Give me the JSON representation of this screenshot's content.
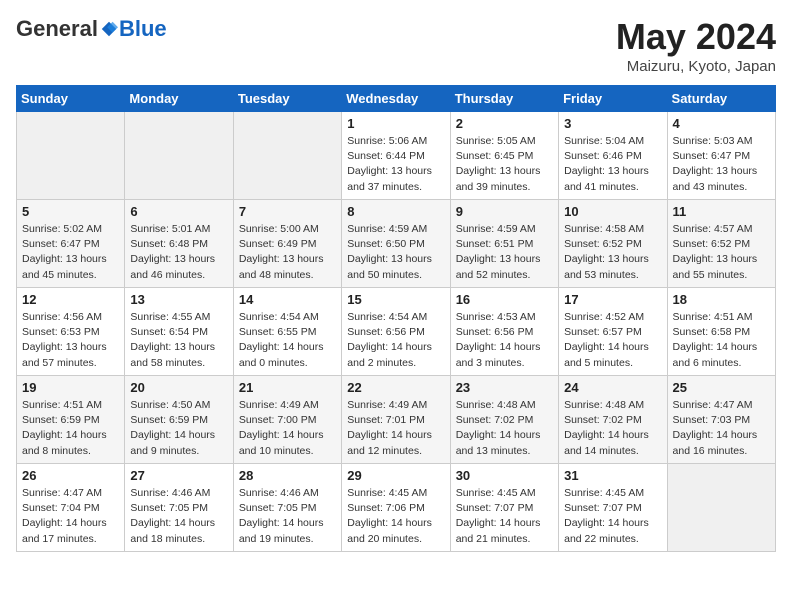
{
  "header": {
    "logo_general": "General",
    "logo_blue": "Blue",
    "month": "May 2024",
    "location": "Maizuru, Kyoto, Japan"
  },
  "weekdays": [
    "Sunday",
    "Monday",
    "Tuesday",
    "Wednesday",
    "Thursday",
    "Friday",
    "Saturday"
  ],
  "weeks": [
    [
      null,
      null,
      null,
      {
        "day": 1,
        "sunrise": "5:06 AM",
        "sunset": "6:44 PM",
        "daylight": "13 hours and 37 minutes."
      },
      {
        "day": 2,
        "sunrise": "5:05 AM",
        "sunset": "6:45 PM",
        "daylight": "13 hours and 39 minutes."
      },
      {
        "day": 3,
        "sunrise": "5:04 AM",
        "sunset": "6:46 PM",
        "daylight": "13 hours and 41 minutes."
      },
      {
        "day": 4,
        "sunrise": "5:03 AM",
        "sunset": "6:47 PM",
        "daylight": "13 hours and 43 minutes."
      }
    ],
    [
      {
        "day": 5,
        "sunrise": "5:02 AM",
        "sunset": "6:47 PM",
        "daylight": "13 hours and 45 minutes."
      },
      {
        "day": 6,
        "sunrise": "5:01 AM",
        "sunset": "6:48 PM",
        "daylight": "13 hours and 46 minutes."
      },
      {
        "day": 7,
        "sunrise": "5:00 AM",
        "sunset": "6:49 PM",
        "daylight": "13 hours and 48 minutes."
      },
      {
        "day": 8,
        "sunrise": "4:59 AM",
        "sunset": "6:50 PM",
        "daylight": "13 hours and 50 minutes."
      },
      {
        "day": 9,
        "sunrise": "4:59 AM",
        "sunset": "6:51 PM",
        "daylight": "13 hours and 52 minutes."
      },
      {
        "day": 10,
        "sunrise": "4:58 AM",
        "sunset": "6:52 PM",
        "daylight": "13 hours and 53 minutes."
      },
      {
        "day": 11,
        "sunrise": "4:57 AM",
        "sunset": "6:52 PM",
        "daylight": "13 hours and 55 minutes."
      }
    ],
    [
      {
        "day": 12,
        "sunrise": "4:56 AM",
        "sunset": "6:53 PM",
        "daylight": "13 hours and 57 minutes."
      },
      {
        "day": 13,
        "sunrise": "4:55 AM",
        "sunset": "6:54 PM",
        "daylight": "13 hours and 58 minutes."
      },
      {
        "day": 14,
        "sunrise": "4:54 AM",
        "sunset": "6:55 PM",
        "daylight": "14 hours and 0 minutes."
      },
      {
        "day": 15,
        "sunrise": "4:54 AM",
        "sunset": "6:56 PM",
        "daylight": "14 hours and 2 minutes."
      },
      {
        "day": 16,
        "sunrise": "4:53 AM",
        "sunset": "6:56 PM",
        "daylight": "14 hours and 3 minutes."
      },
      {
        "day": 17,
        "sunrise": "4:52 AM",
        "sunset": "6:57 PM",
        "daylight": "14 hours and 5 minutes."
      },
      {
        "day": 18,
        "sunrise": "4:51 AM",
        "sunset": "6:58 PM",
        "daylight": "14 hours and 6 minutes."
      }
    ],
    [
      {
        "day": 19,
        "sunrise": "4:51 AM",
        "sunset": "6:59 PM",
        "daylight": "14 hours and 8 minutes."
      },
      {
        "day": 20,
        "sunrise": "4:50 AM",
        "sunset": "6:59 PM",
        "daylight": "14 hours and 9 minutes."
      },
      {
        "day": 21,
        "sunrise": "4:49 AM",
        "sunset": "7:00 PM",
        "daylight": "14 hours and 10 minutes."
      },
      {
        "day": 22,
        "sunrise": "4:49 AM",
        "sunset": "7:01 PM",
        "daylight": "14 hours and 12 minutes."
      },
      {
        "day": 23,
        "sunrise": "4:48 AM",
        "sunset": "7:02 PM",
        "daylight": "14 hours and 13 minutes."
      },
      {
        "day": 24,
        "sunrise": "4:48 AM",
        "sunset": "7:02 PM",
        "daylight": "14 hours and 14 minutes."
      },
      {
        "day": 25,
        "sunrise": "4:47 AM",
        "sunset": "7:03 PM",
        "daylight": "14 hours and 16 minutes."
      }
    ],
    [
      {
        "day": 26,
        "sunrise": "4:47 AM",
        "sunset": "7:04 PM",
        "daylight": "14 hours and 17 minutes."
      },
      {
        "day": 27,
        "sunrise": "4:46 AM",
        "sunset": "7:05 PM",
        "daylight": "14 hours and 18 minutes."
      },
      {
        "day": 28,
        "sunrise": "4:46 AM",
        "sunset": "7:05 PM",
        "daylight": "14 hours and 19 minutes."
      },
      {
        "day": 29,
        "sunrise": "4:45 AM",
        "sunset": "7:06 PM",
        "daylight": "14 hours and 20 minutes."
      },
      {
        "day": 30,
        "sunrise": "4:45 AM",
        "sunset": "7:07 PM",
        "daylight": "14 hours and 21 minutes."
      },
      {
        "day": 31,
        "sunrise": "4:45 AM",
        "sunset": "7:07 PM",
        "daylight": "14 hours and 22 minutes."
      },
      null
    ]
  ]
}
